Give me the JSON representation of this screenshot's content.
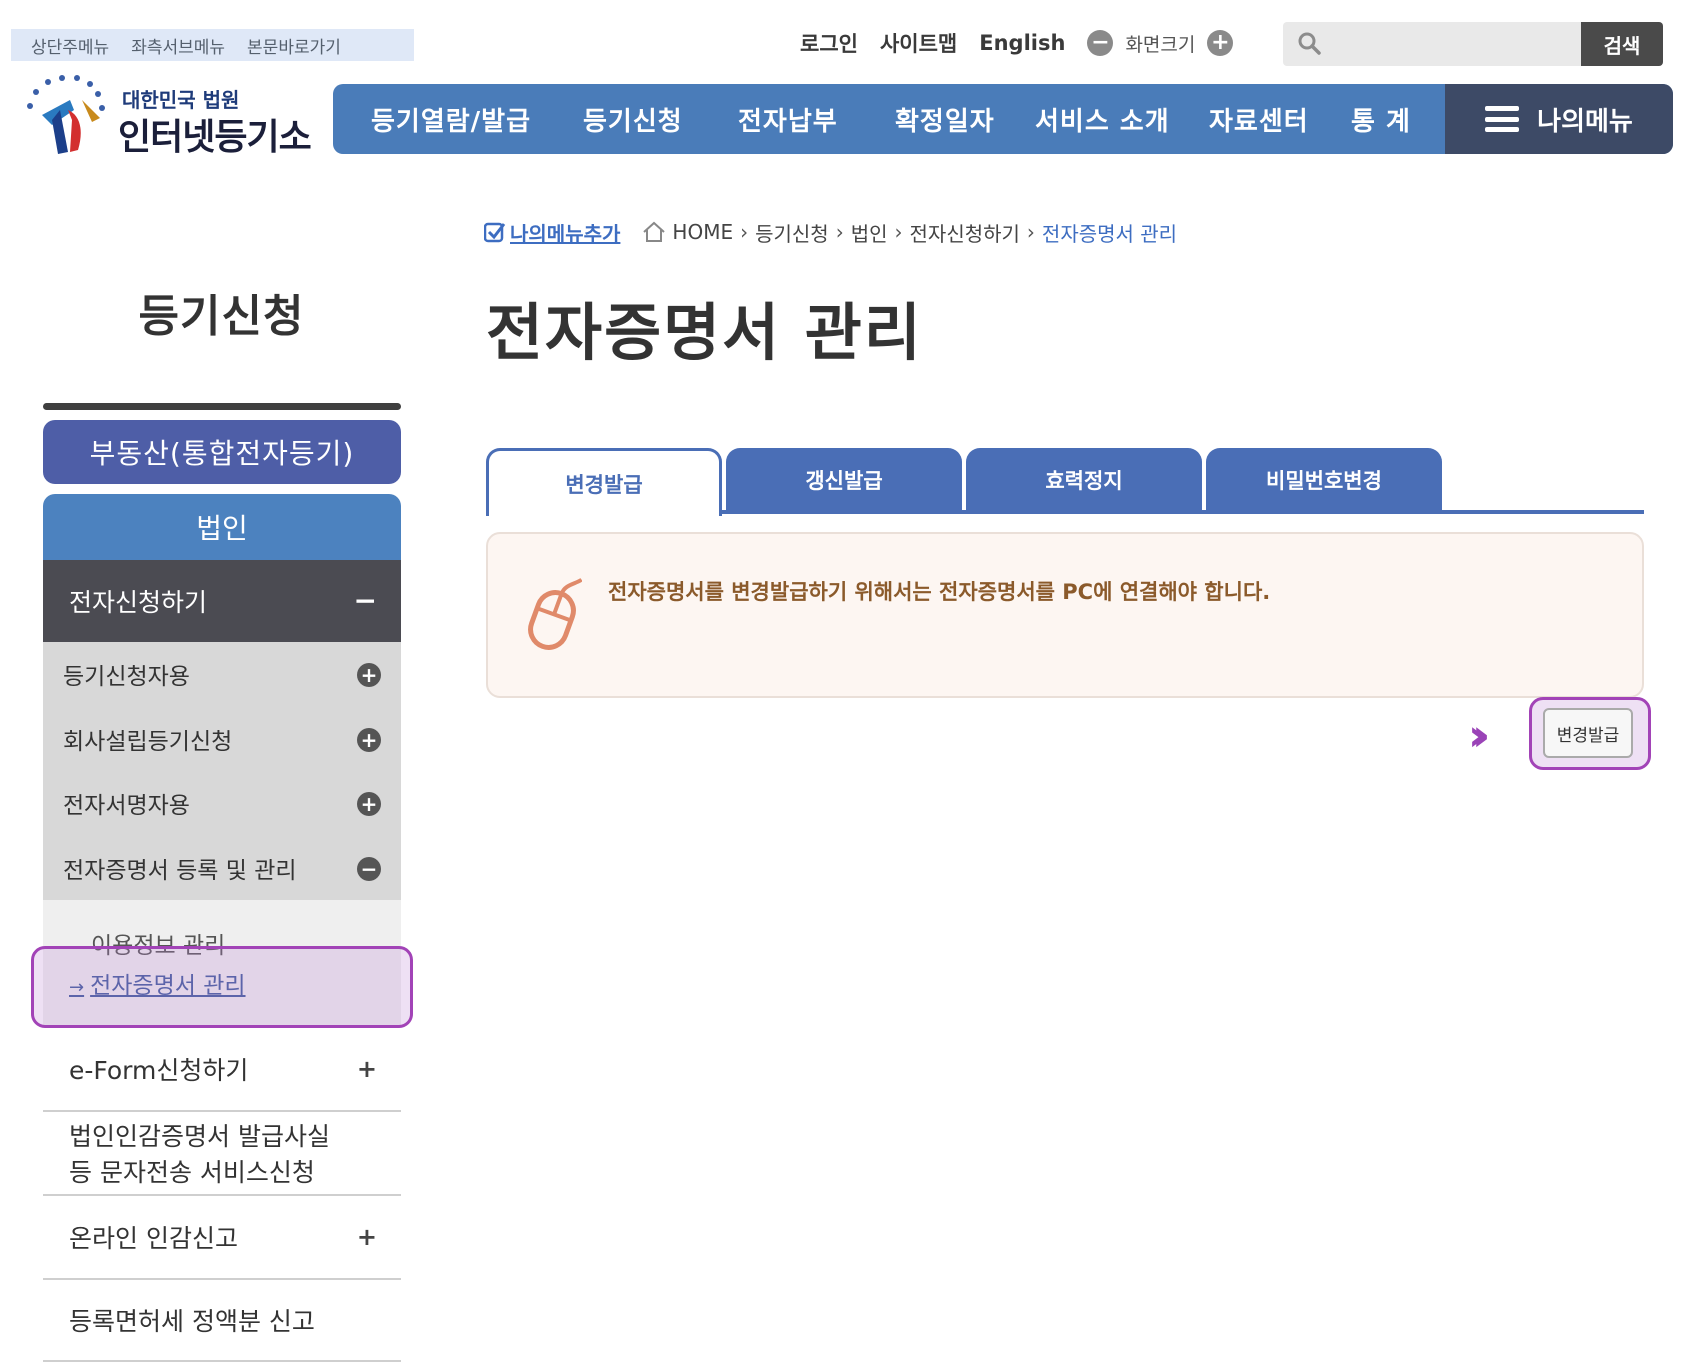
{
  "skip_links": [
    "상단주메뉴",
    "좌측서브메뉴",
    "본문바로가기"
  ],
  "util": {
    "login": "로그인",
    "sitemap": "사이트맵",
    "english": "English",
    "zoom": "화면크기",
    "search_button": "검색",
    "search_placeholder": ""
  },
  "logo": {
    "sub": "대한민국 법원",
    "main": "인터넷등기소"
  },
  "gnb": [
    "등기열람/발급",
    "등기신청",
    "전자납부",
    "확정일자",
    "서비스 소개",
    "자료센터",
    "통 계"
  ],
  "my_menu": "나의메뉴",
  "breadcrumb": {
    "add_my_menu": "나의메뉴추가",
    "items": [
      "HOME",
      "등기신청",
      "법인",
      "전자신청하기",
      "전자증명서 관리"
    ]
  },
  "side": {
    "title": "등기신청",
    "real_estate": "부동산(통합전자등기)",
    "corp": "법인",
    "section": "전자신청하기",
    "sub_items": [
      "등기신청자용",
      "회사설립등기신청",
      "전자서명자용",
      "전자증명서 등록 및 관리"
    ],
    "sub3": [
      "이용정보 관리",
      "전자증명서 관리"
    ],
    "others": [
      {
        "label": "e-Form신청하기"
      },
      {
        "label1": "법인인감증명서 발급사실",
        "label2": "등 문자전송 서비스신청"
      },
      {
        "label": "온라인 인감신고"
      },
      {
        "label": "등록면허세 정액분 신고"
      }
    ]
  },
  "page_title": "전자증명서 관리",
  "tabs": [
    "변경발급",
    "갱신발급",
    "효력정지",
    "비밀번호변경"
  ],
  "notice": "전자증명서를 변경발급하기 위해서는 전자증명서를 PC에 연결해야 합니다.",
  "issue_button": "변경발급",
  "colors": {
    "gnb": "#4a7cb9",
    "gnb_mymenu": "#3d4a66",
    "tab": "#4a6eb6",
    "highlight": "#a243b7",
    "notice_text": "#8b5a2b"
  }
}
